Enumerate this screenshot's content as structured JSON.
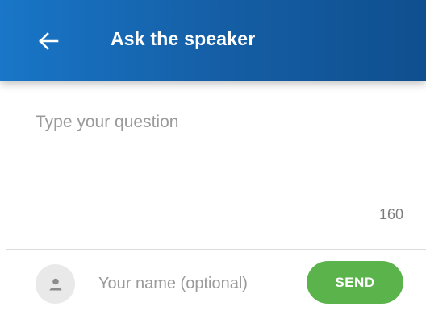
{
  "header": {
    "title": "Ask the speaker",
    "back_icon": "arrow-left-icon"
  },
  "question": {
    "placeholder": "Type your question",
    "value": "",
    "char_counter": "160"
  },
  "footer": {
    "avatar_icon": "person-icon",
    "name_placeholder": "Your name (optional)",
    "name_value": "",
    "send_label": "SEND"
  },
  "colors": {
    "header_gradient_start": "#1976c8",
    "header_gradient_end": "#0f4f8f",
    "send_button": "#5bb34c",
    "placeholder_text": "#9a9a9a"
  }
}
